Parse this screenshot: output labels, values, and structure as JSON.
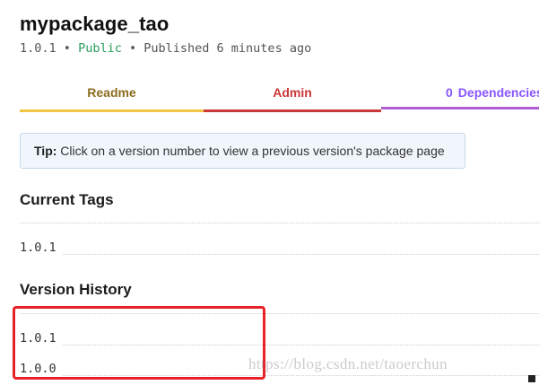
{
  "package": {
    "name": "mypackage_tao",
    "version": "1.0.1",
    "separator": "•",
    "visibility": "Public",
    "published": "Published 6 minutes ago"
  },
  "tabs": [
    {
      "label": "Readme",
      "color": "#f4c542"
    },
    {
      "label": "Admin",
      "color": "#cb3837"
    },
    {
      "count": "0",
      "label": "Dependencies",
      "color": "#b05fd0"
    }
  ],
  "tip": {
    "label": "Tip:",
    "text": "Click on a version number to view a previous version's package page"
  },
  "current_tags": {
    "heading": "Current Tags",
    "versions": [
      "1.0.1"
    ]
  },
  "version_history": {
    "heading": "Version History",
    "versions": [
      "1.0.1",
      "1.0.0"
    ]
  },
  "annotation": {
    "highlight_color": "#e8222b"
  },
  "watermark": "https://blog.csdn.net/taoerchun"
}
